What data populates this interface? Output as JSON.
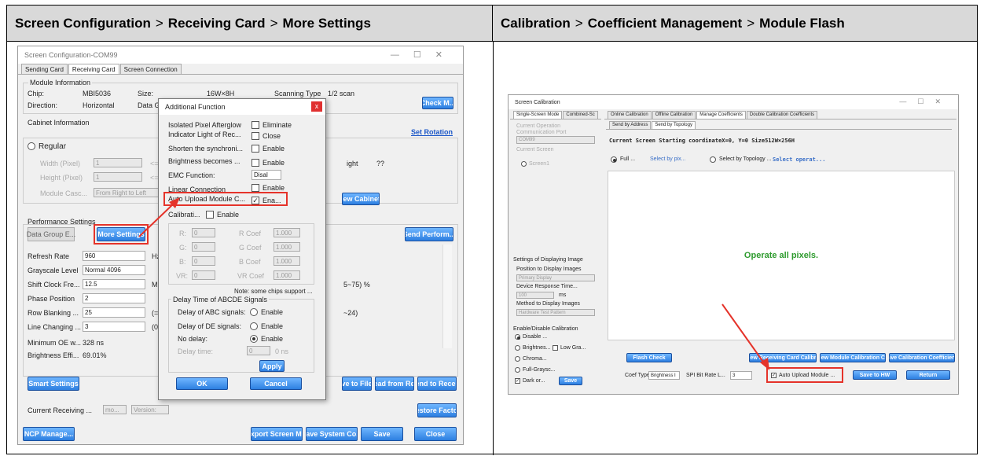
{
  "left_header": {
    "part1": "Screen Configuration",
    "part2": "Receiving Card",
    "part3": "More Settings",
    "sep": ">"
  },
  "right_header": {
    "part1": "Calibration",
    "part2": "Coefficient Management",
    "part3": "Module Flash",
    "sep": ">"
  },
  "left_window": {
    "title": "Screen Configuration-COM99",
    "tabs": [
      "Sending Card",
      "Receiving Card",
      "Screen Connection"
    ],
    "module_info": {
      "group": "Module Information",
      "chip_label": "Chip:",
      "chip": "MBI5036",
      "size_label": "Size:",
      "size": "16W×8H",
      "scan_label": "Scanning Type",
      "scan": "1/2 scan",
      "direction_label": "Direction:",
      "direction": "Horizontal",
      "datag_label": "Data G",
      "check_button": "Check M..."
    },
    "cabinet": {
      "group": "Cabinet Information",
      "set_rotation": "Set Rotation",
      "regular": "Regular",
      "width_label": "Width (Pixel)",
      "width": "1",
      "height_label": "Height (Pixel)",
      "height": "1",
      "cascade_label": "Module Casc...",
      "cascade": "From Right to Left",
      "lt1": "<=",
      "lt2": "<=",
      "right_label": "ight",
      "right_value": "??",
      "view_button": "iew Cabinet"
    },
    "performance": {
      "group": "Performance Settings",
      "data_group_button": "Data Group E...",
      "more_settings_button": "More Settings",
      "send_perf_button": "Send Perform...",
      "refresh_label": "Refresh Rate",
      "refresh": "960",
      "refresh_unit": "Hz",
      "gray_label": "Grayscale Level",
      "gray": "Normal 4096",
      "shift_label": "Shift Clock Fre...",
      "shift": "12.5",
      "shift_unit": "MH",
      "phase_label": "Phase Position",
      "phase": "2",
      "row_label": "Row Blanking ...",
      "row": "25",
      "row_range": "(=2.",
      "line_label": "Line Changing ...",
      "line": "3",
      "line_range": "(0~1",
      "min_oe_label": "Minimum OE w...",
      "min_oe": "328 ns",
      "bright_label": "Brightness Effi...",
      "bright": "69.01%",
      "range1": "5~75) %",
      "range2": "~24)"
    },
    "smart_button": "Smart Settings",
    "save_file_button": "ve to File",
    "read_button": "Read from Re...",
    "send_recv_button": "Send to Recei...",
    "current_label": "Current Receiving ...",
    "current_mo": "mo...",
    "current_version": "Version:",
    "restore_button": "Restore Facto...",
    "ncp_button": "NCP Manage...",
    "export_button": "Export Screen M...",
    "save_sys_button": "Save System Co...",
    "save_button": "Save",
    "close_button": "Close"
  },
  "dialog": {
    "title": "Additional Function",
    "close": "x",
    "rows": [
      {
        "label": "Isolated Pixel Afterglow",
        "opt": "Eliminate"
      },
      {
        "label": "Indicator Light of Rec...",
        "opt": "Close"
      },
      {
        "label": "Shorten the synchroni...",
        "opt": "Enable"
      },
      {
        "label": "Brightness becomes ...",
        "opt": "Enable"
      },
      {
        "label": "EMC Function:",
        "opt": "Disal"
      },
      {
        "label": "Linear Connection",
        "opt": "Enable"
      },
      {
        "label": "Auto Upload Module C...",
        "opt": "Ena..."
      }
    ],
    "calib_label": "Calibrati...",
    "calib_opt": "Enable",
    "coef": [
      {
        "l": "R:",
        "v": "0",
        "c": "R Coef",
        "cv": "1.000"
      },
      {
        "l": "G:",
        "v": "0",
        "c": "G Coef",
        "cv": "1.000"
      },
      {
        "l": "B:",
        "v": "0",
        "c": "B Coef",
        "cv": "1.000"
      },
      {
        "l": "VR:",
        "v": "0",
        "c": "VR Coef",
        "cv": "1.000"
      }
    ],
    "note": "Note: some chips support ...",
    "delay_group": "Delay Time of ABCDE Signals",
    "delay_abc": "Delay of ABC signals:",
    "delay_de": "Delay of DE signals:",
    "no_delay": "No delay:",
    "enable": "Enable",
    "delay_time": "Delay time:",
    "delay_value": "0",
    "delay_unit": "0 ns",
    "apply": "Apply",
    "ok": "OK",
    "cancel": "Cancel"
  },
  "right_window": {
    "title": "Screen Calibration",
    "left_tabs": [
      "Single-Screen Mode",
      "Combined-Sc"
    ],
    "tabs": [
      "Online Calibration",
      "Offline Calibration",
      "Manage Coefficients",
      "Double Calibration Coefficients"
    ],
    "subtabs": [
      "Send by Address",
      "Send by Topology"
    ],
    "current_op": "Current Operation",
    "comm_port": "Communication Port",
    "com": "COM99",
    "current_screen": "Current Screen",
    "screen1": "Screen1",
    "screen_info": "Current Screen  Starting coordinateX=0, Y=0  Size512W×256H",
    "full": "Full ...",
    "select_pix": "Select by pix...",
    "select_topo": "Select by Topology ...",
    "select_op": "Select operat...",
    "operate": "Operate all pixels.",
    "settings_group": "Settings of Displaying Image",
    "position": "Position to Display Images",
    "primary": "Primary Display",
    "response": "Device Response Time...",
    "response_val": "100",
    "ms": "ms",
    "method": "Method to Display Images",
    "hardware": "Hardware Test Pattern",
    "enable_group": "Enable/Disable Calibration",
    "disable": "Disable ...",
    "brightness": "Brightnes...",
    "low_gra": "Low Gra...",
    "chroma": "Chroma...",
    "full_gray": "Full-Graysc...",
    "dark": "Dark or...",
    "save": "Save",
    "flash_check": "Flash Check",
    "view_recv": "View Receiving Card Calibr...",
    "view_module": "View Module Calibration C...",
    "save_coef": "Save Calibration Coefficien...",
    "coef_type": "Coef Type:",
    "coef_val": "Brightness I",
    "spi": "SPI Bit Rate L...",
    "spi_val": "3",
    "auto_upload": "Auto Upload Module ...",
    "save_hw": "Save to HW",
    "return": "Return"
  }
}
